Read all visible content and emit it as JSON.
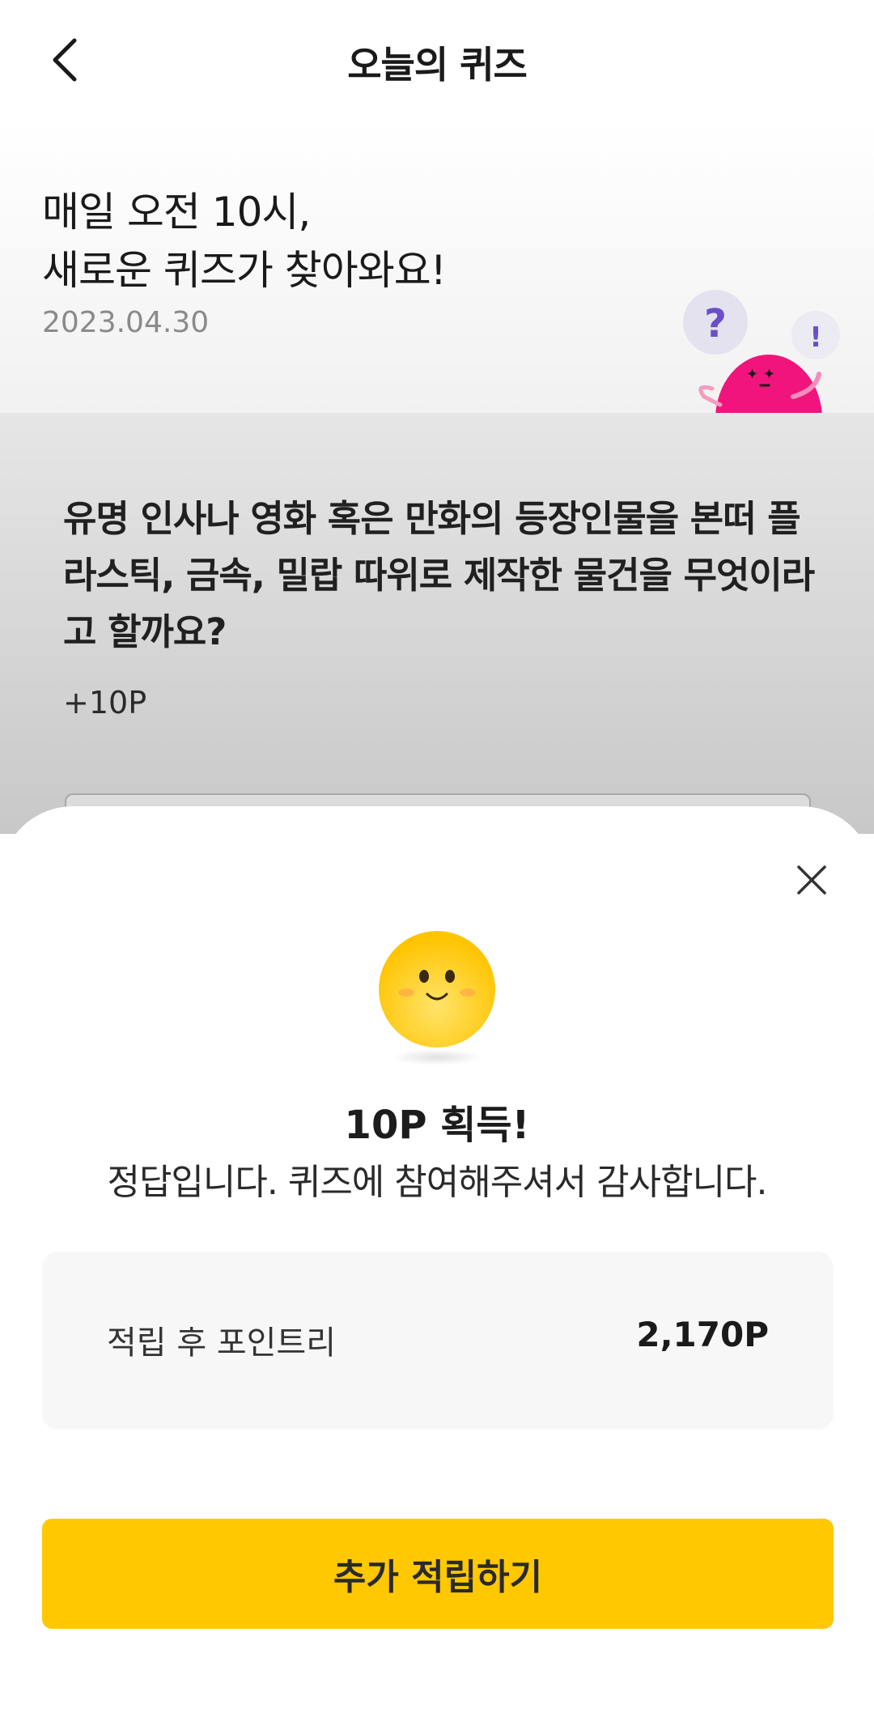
{
  "header": {
    "title": "오늘의 퀴즈",
    "back_icon": "chevron-left-icon"
  },
  "hero": {
    "title_line1": "매일 오전 10시,",
    "title_line2": "새로운 퀴즈가 찾아와요!",
    "date": "2023.04.30",
    "mascot_question": "?",
    "mascot_exclaim": "!",
    "mascot_color": "#f0147c"
  },
  "quiz": {
    "question": "유명 인사나 영화 혹은 만화의 등장인물을 본떠 플라스틱, 금속, 밀랍 따위로 제작한 물건을 무엇이라고 할까요?",
    "points": "+10P"
  },
  "result_sheet": {
    "close_icon": "close-icon",
    "emoji_icon": "smile-emoji-icon",
    "title": "10P 획득!",
    "message": "정답입니다. 퀴즈에 참여해주셔서 감사합니다.",
    "points_label": "적립 후 포인트리",
    "points_value": "2,170P",
    "cta_label": "추가 적립하기",
    "accent_color": "#ffc800"
  }
}
